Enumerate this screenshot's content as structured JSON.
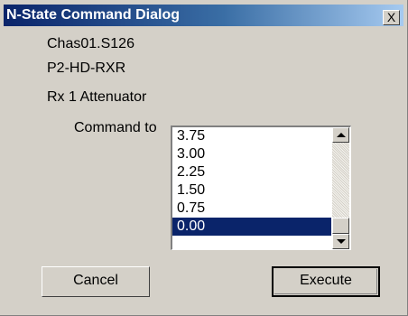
{
  "window": {
    "title": "N-State Command Dialog",
    "close_glyph": "X"
  },
  "info": {
    "line1": "Chas01.S126",
    "line2": "P2-HD-RXR",
    "line3": "Rx 1 Attenuator"
  },
  "command": {
    "label": "Command to",
    "options": [
      "3.75",
      "3.00",
      "2.25",
      "1.50",
      "0.75",
      "0.00"
    ],
    "selected": "0.00"
  },
  "buttons": {
    "cancel": "Cancel",
    "execute": "Execute"
  },
  "colors": {
    "face": "#d4d0c8",
    "title_active": "#0a246a",
    "selection": "#0a246a"
  },
  "icons": {
    "close": "close-icon",
    "scroll_up": "scroll-up-arrow-icon",
    "scroll_down": "scroll-down-arrow-icon"
  }
}
